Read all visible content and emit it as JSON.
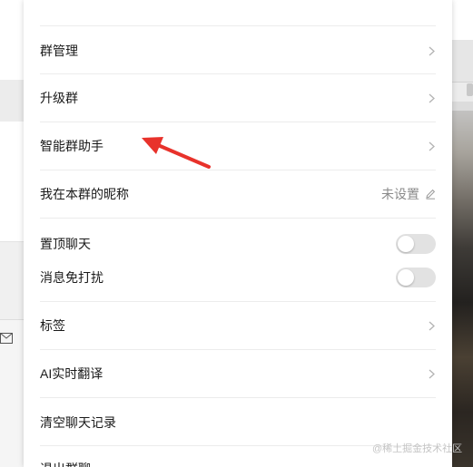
{
  "settings": {
    "items": [
      {
        "label": "群管理"
      },
      {
        "label": "升级群"
      },
      {
        "label": "智能群助手"
      },
      {
        "label": "我在本群的昵称",
        "value": "未设置"
      },
      {
        "label": "置顶聊天",
        "toggle_on": false
      },
      {
        "label": "消息免打扰",
        "toggle_on": false
      },
      {
        "label": "标签"
      },
      {
        "label": "AI实时翻译"
      },
      {
        "label": "清空聊天记录"
      },
      {
        "label": "退出群聊"
      }
    ]
  },
  "icons": {
    "chevron": "chevron-right-icon",
    "edit": "pencil-icon",
    "mail": "mail-icon",
    "annotation": "red-arrow-annotation"
  },
  "colors": {
    "annotation_arrow": "#e8322b",
    "toggle_off": "#e2e2e2",
    "muted_text": "#8a8a8a"
  },
  "watermark": "@稀土掘金技术社区"
}
